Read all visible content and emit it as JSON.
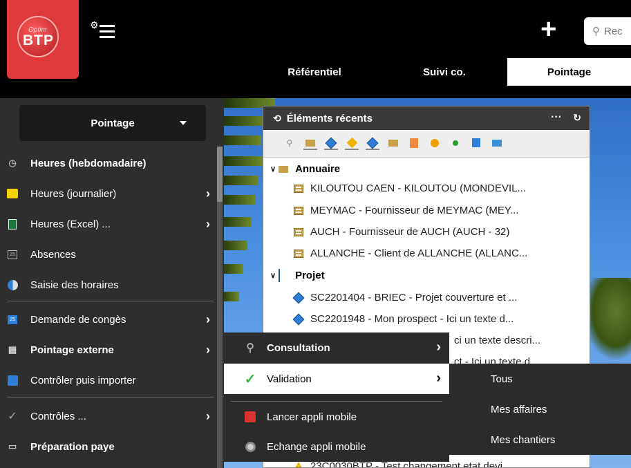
{
  "header": {
    "logo": {
      "top_text": "Optim",
      "brand": "BTP"
    },
    "search_placeholder": "Rec",
    "tabs": [
      {
        "label": "Référentiel"
      },
      {
        "label": "Suivi co."
      },
      {
        "label": "Pointage",
        "active": true
      }
    ]
  },
  "sidebar": {
    "dropdown_label": "Pointage",
    "items": [
      {
        "label": "Heures (hebdomadaire)",
        "icon": "clock-icon",
        "bold": true,
        "chevron": false
      },
      {
        "label": "Heures (journalier)",
        "icon": "note-icon",
        "bold": false,
        "chevron": true
      },
      {
        "label": "Heures (Excel) ...",
        "icon": "excel-icon",
        "bold": false,
        "chevron": true
      },
      {
        "label": "Absences",
        "icon": "calendar-icon",
        "bold": false,
        "chevron": false
      },
      {
        "label": "Saisie des horaires",
        "icon": "pie-icon",
        "bold": false,
        "chevron": false
      },
      {
        "label": "Demande de congès",
        "icon": "calendar-blue-icon",
        "bold": false,
        "chevron": true
      },
      {
        "label": "Pointage externe",
        "icon": "external-icon",
        "bold": true,
        "chevron": true,
        "selected": true
      },
      {
        "label": "Contrôler puis importer",
        "icon": "import-icon",
        "bold": false,
        "chevron": false
      },
      {
        "label": "Contrôles ...",
        "icon": "check-icon",
        "bold": false,
        "chevron": true
      },
      {
        "label": "Préparation paye",
        "icon": "pay-icon",
        "bold": true,
        "chevron": false
      }
    ]
  },
  "recent": {
    "title": "Éléments récents",
    "more": "···",
    "groups": [
      {
        "label": "Annuaire",
        "rows": [
          "KILOUTOU CAEN - KILOUTOU (MONDEVIL...",
          "MEYMAC - Fournisseur de MEYMAC (MEY...",
          "AUCH - Fournisseur de AUCH (AUCH - 32)",
          "ALLANCHE - Client de ALLANCHE (ALLANC..."
        ]
      },
      {
        "label": "Projet",
        "rows": [
          "SC2201404 - BRIEC - Projet couverture et ...",
          "SC2201948 - Mon prospect - Ici un texte d...",
          "ci un texte descri...",
          "ct - Ici un texte d..."
        ]
      }
    ],
    "bottom_row": "23C0030BTP - Test changement etat devi"
  },
  "submenu": {
    "items": [
      {
        "label": "Consultation",
        "icon": "search-icon",
        "bold": true,
        "chevron": true
      },
      {
        "label": "Validation",
        "icon": "checkmark-icon",
        "bold": false,
        "chevron": true,
        "selected": true
      },
      {
        "label": "Lancer appli mobile",
        "icon": "mobile-app-icon",
        "bold": false,
        "chevron": false
      },
      {
        "label": "Echange appli mobile",
        "icon": "sync-icon",
        "bold": false,
        "chevron": false
      }
    ]
  },
  "submenu2": {
    "items": [
      "Tous",
      "Mes affaires",
      "Mes chantiers"
    ]
  },
  "colors": {
    "brand_red": "#e0393a",
    "sidebar_bg": "#2e2e2e",
    "accent_blue": "#2f7ed8",
    "check_green": "#3cb043"
  }
}
